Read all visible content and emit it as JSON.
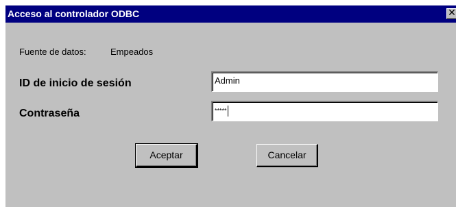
{
  "window": {
    "title": "Acceso al controlador ODBC",
    "close_glyph": "✕"
  },
  "datasource": {
    "label": "Fuente de datos:",
    "value": "Empeados"
  },
  "login": {
    "user_label": "ID de inicio de sesión",
    "user_value": "Admin",
    "password_label": "Contraseña",
    "password_value": "*****"
  },
  "buttons": {
    "ok_label": "Aceptar",
    "cancel_label": "Cancelar"
  },
  "colors": {
    "titlebar": "#000080",
    "dialog_bg": "#c0c0c0"
  }
}
